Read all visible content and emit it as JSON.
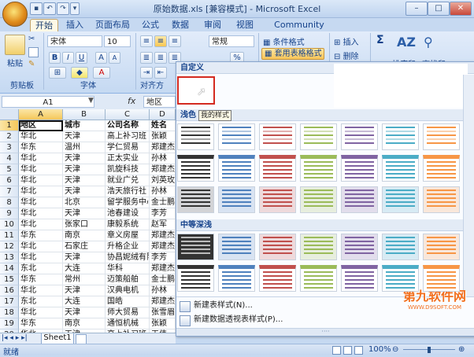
{
  "window": {
    "title": "原始数据.xls [兼容模式] - Microsoft Excel"
  },
  "tabs": [
    "开始",
    "插入",
    "页面布局",
    "公式",
    "数据",
    "审阅",
    "视图",
    "Community Clips"
  ],
  "ribbon": {
    "paste_label": "粘贴",
    "clipboard_label": "剪贴板",
    "font_name": "宋体",
    "font_size": "10",
    "font_label": "字体",
    "bold": "B",
    "italic": "I",
    "underline": "U",
    "grow": "A",
    "shrink": "A",
    "align_label": "对齐方",
    "number_format": "常规",
    "percent": "%",
    "cond_format": "条件格式",
    "table_format": "套用表格格式",
    "insert": "插入",
    "delete": "删除",
    "sigma": "Σ",
    "sort_label": "排序和",
    "find_label": "查找和"
  },
  "formula_bar": {
    "name_box": "A1",
    "fx": "fx",
    "value": "地区"
  },
  "columns": [
    "A",
    "B",
    "C",
    "D"
  ],
  "rows": [
    [
      "地区",
      "城市",
      "公司名称",
      "姓名"
    ],
    [
      "华北",
      "天津",
      "高上补习班",
      "张颖"
    ],
    [
      "华东",
      "温州",
      "学仁贸易",
      "郑建杰"
    ],
    [
      "华北",
      "天津",
      "正太实业",
      "孙林"
    ],
    [
      "华北",
      "天津",
      "凯旋科技",
      "郑建杰"
    ],
    [
      "华北",
      "天津",
      "就业广兑",
      "刘英玫"
    ],
    [
      "华北",
      "天津",
      "浩天旅行社",
      "孙林"
    ],
    [
      "华北",
      "北京",
      "留学服务中心",
      "金士鹏"
    ],
    [
      "华北",
      "天津",
      "池春建设",
      "李芳"
    ],
    [
      "华北",
      "张家口",
      "康毅系统",
      "赵军"
    ],
    [
      "华东",
      "南京",
      "章义房屋",
      "郑建杰"
    ],
    [
      "华北",
      "石家庄",
      "升格企业",
      "郑建杰"
    ],
    [
      "华北",
      "天津",
      "协昌妮绒有限",
      "李芳"
    ],
    [
      "东北",
      "大连",
      "华科",
      "郑建杰"
    ],
    [
      "华东",
      "常州",
      "迈策船舶",
      "金士鹏"
    ],
    [
      "华北",
      "天津",
      "汉典电机",
      "孙林"
    ],
    [
      "东北",
      "大连",
      "国皓",
      "郑建杰"
    ],
    [
      "华北",
      "天津",
      "师大贸易",
      "张雪眉"
    ],
    [
      "华东",
      "南京",
      "通恒机械",
      "张颖"
    ],
    [
      "华北",
      "天津",
      "高上补习班",
      "王伟"
    ]
  ],
  "sheet_tab": "Sheet1",
  "status": {
    "ready": "就绪",
    "zoom": "100%"
  },
  "gallery": {
    "custom_header": "自定义",
    "light_header": "浅色",
    "medium_header": "中等深浅",
    "tooltip": "我的样式",
    "new_table_style": "新建表样式(N)...",
    "new_pivot_style": "新建数据透视表样式(P)..."
  },
  "watermark": {
    "text": "第九软件网",
    "url": "WWW.D9SOFT.COM"
  },
  "thumb_colors": {
    "row1": [
      "#333333",
      "#4f81bd",
      "#c0504d",
      "#9bbb59",
      "#8064a2",
      "#4bacc6",
      "#f79646"
    ],
    "medium": [
      "#333333",
      "#4f81bd",
      "#c0504d",
      "#9bbb59",
      "#8064a2",
      "#4bacc6",
      "#f79646"
    ]
  }
}
